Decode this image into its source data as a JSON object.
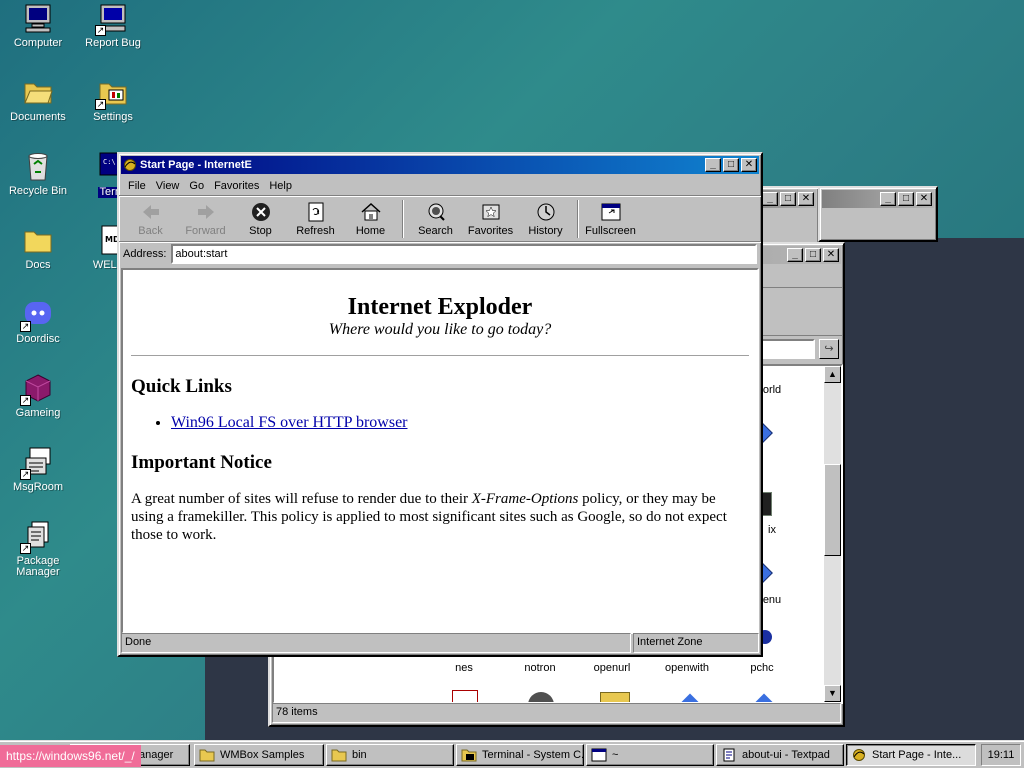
{
  "desktop": {
    "icons": [
      {
        "label": "Computer",
        "icon": "computer-icon"
      },
      {
        "label": "Report Bug",
        "icon": "report-bug-icon"
      },
      {
        "label": "Documents",
        "icon": "folder-open-icon"
      },
      {
        "label": "Settings",
        "icon": "settings-icon"
      },
      {
        "label": "Recycle Bin",
        "icon": "recycle-bin-icon"
      },
      {
        "label": "Termi",
        "icon": "terminal-icon"
      },
      {
        "label": "Docs",
        "icon": "folder-icon"
      },
      {
        "label": "WELCO",
        "icon": "welcome-icon"
      },
      {
        "label": "Doordisc",
        "icon": "discord-icon"
      },
      {
        "label": "Gameing",
        "icon": "game-cube-icon"
      },
      {
        "label": "MsgRoom",
        "icon": "msgroom-icon"
      },
      {
        "label": "Package Manager",
        "icon": "package-icon"
      }
    ]
  },
  "browser": {
    "title": "Start Page - InternetE",
    "menu": [
      "File",
      "View",
      "Go",
      "Favorites",
      "Help"
    ],
    "toolbar": {
      "back": "Back",
      "forward": "Forward",
      "stop": "Stop",
      "refresh": "Refresh",
      "home": "Home",
      "search": "Search",
      "favorites": "Favorites",
      "history": "History",
      "fullscreen": "Fullscreen"
    },
    "address_label": "Address:",
    "address_value": "about:start",
    "page": {
      "heading": "Internet Exploder",
      "subheading": "Where would you like to go today?",
      "quick_links_heading": "Quick Links",
      "quick_links": [
        "Win96 Local FS over HTTP browser"
      ],
      "notice_heading": "Important Notice",
      "notice_pre": "A great number of sites will refuse to render due to their ",
      "notice_em": "X-Frame-Options",
      "notice_post": " policy, or they may be using a framekiller. This policy is applied to most significant sites such as Google, so do not expect those to work."
    },
    "status_left": "Done",
    "status_right": "Internet Zone"
  },
  "explorer": {
    "visible_labels": [
      "orld",
      "ix",
      "enu"
    ],
    "files": [
      "nes",
      "notron",
      "openurl",
      "openwith",
      "pchc"
    ],
    "status": "78 items"
  },
  "taskbar": {
    "url_tooltip": "https://windows96.net/_/",
    "tasks": [
      {
        "label": "anager"
      },
      {
        "label": "WMBox Samples"
      },
      {
        "label": "bin"
      },
      {
        "label": "Terminal - System C..."
      },
      {
        "label": "~"
      },
      {
        "label": "about-ui - Textpad"
      },
      {
        "label": "Start Page - Inte..."
      }
    ],
    "clock": "19:11"
  },
  "colors": {
    "titlebar_active": "#000080",
    "face": "#c0c0c0",
    "tooltip": "#f06c98",
    "link": "#0000aa"
  }
}
